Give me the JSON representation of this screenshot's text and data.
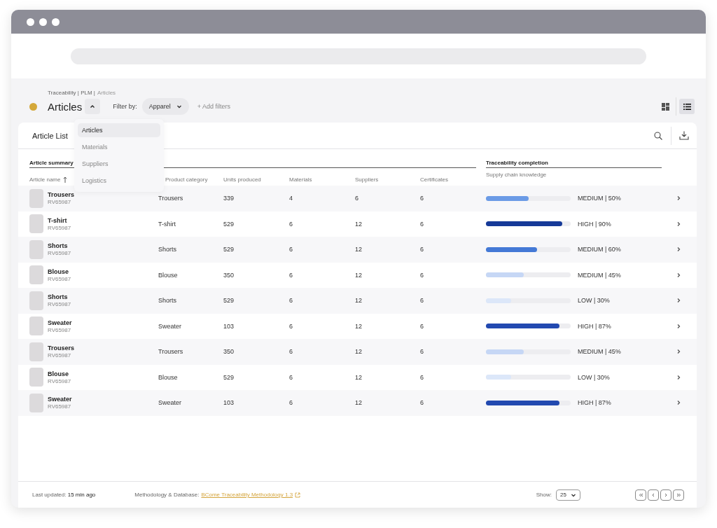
{
  "breadcrumb": {
    "path": "Traceability | PLM |",
    "current": "Articles"
  },
  "title": "Articles",
  "title_menu_expanded": true,
  "filter": {
    "label": "Filter by:",
    "value": "Apparel",
    "add": "+ Add filters"
  },
  "views": [
    {
      "kind": "grid",
      "selected": false
    },
    {
      "kind": "list",
      "selected": true
    }
  ],
  "menu": [
    {
      "label": "Articles",
      "selected": true
    },
    {
      "label": "Materials",
      "selected": false
    },
    {
      "label": "Suppliers",
      "selected": false
    },
    {
      "label": "Logistics",
      "selected": false
    }
  ],
  "card_title": "Article List",
  "groups": [
    "Article summary",
    "Traceability completion"
  ],
  "columns": [
    "Article name",
    "Product category",
    "Units produced",
    "Materials",
    "Suppliers",
    "Certificates",
    "Supply chain knowledge"
  ],
  "rows": [
    {
      "name": "Trousers",
      "code": "RV65987",
      "category": "Trousers",
      "units": "339",
      "materials": "4",
      "suppliers": "6",
      "certificates": "6",
      "level": 0.5,
      "color": "#6b9be6",
      "status": "MEDIUM | 50%"
    },
    {
      "name": "T-shirt",
      "code": "RV65987",
      "category": "T-shirt",
      "units": "529",
      "materials": "6",
      "suppliers": "12",
      "certificates": "6",
      "level": 0.9,
      "color": "#163a98",
      "status": "HIGH | 90%"
    },
    {
      "name": "Shorts",
      "code": "RV65987",
      "category": "Shorts",
      "units": "529",
      "materials": "6",
      "suppliers": "12",
      "certificates": "6",
      "level": 0.6,
      "color": "#4479d6",
      "status": "MEDIUM | 60%"
    },
    {
      "name": "Blouse",
      "code": "RV65987",
      "category": "Blouse",
      "units": "350",
      "materials": "6",
      "suppliers": "12",
      "certificates": "6",
      "level": 0.45,
      "color": "#c6d7f5",
      "status": "MEDIUM | 45%"
    },
    {
      "name": "Shorts",
      "code": "RV65987",
      "category": "Shorts",
      "units": "529",
      "materials": "6",
      "suppliers": "12",
      "certificates": "6",
      "level": 0.3,
      "color": "#dce7f9",
      "status": "LOW | 30%"
    },
    {
      "name": "Sweater",
      "code": "RV65987",
      "category": "Sweater",
      "units": "103",
      "materials": "6",
      "suppliers": "12",
      "certificates": "6",
      "level": 0.87,
      "color": "#2249b0",
      "status": "HIGH | 87%"
    },
    {
      "name": "Trousers",
      "code": "RV65987",
      "category": "Trousers",
      "units": "350",
      "materials": "6",
      "suppliers": "12",
      "certificates": "6",
      "level": 0.45,
      "color": "#c6d7f5",
      "status": "MEDIUM | 45%"
    },
    {
      "name": "Blouse",
      "code": "RV65987",
      "category": "Blouse",
      "units": "529",
      "materials": "6",
      "suppliers": "12",
      "certificates": "6",
      "level": 0.3,
      "color": "#dce7f9",
      "status": "LOW | 30%"
    },
    {
      "name": "Sweater",
      "code": "RV65987",
      "category": "Sweater",
      "units": "103",
      "materials": "6",
      "suppliers": "12",
      "certificates": "6",
      "level": 0.87,
      "color": "#2249b0",
      "status": "HIGH | 87%"
    }
  ],
  "footer": {
    "updated_label": "Last updated:",
    "updated_value": "15 min ago",
    "method_label": "Methodology & Database:",
    "method_link": "BCome Traceability Methodology 1.3",
    "show_label": "Show:",
    "show_value": "25"
  }
}
